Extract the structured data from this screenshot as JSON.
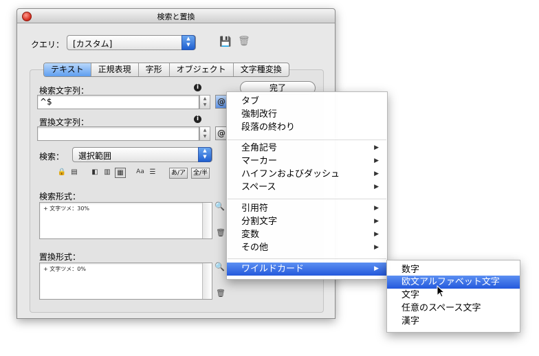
{
  "window": {
    "title": "検索と置換"
  },
  "query": {
    "label": "クエリ：",
    "value": "[カスタム]"
  },
  "tabs": [
    "テキスト",
    "正規表現",
    "字形",
    "オブジェクト",
    "文字種変換"
  ],
  "done_label": "完了",
  "find": {
    "label": "検索文字列：",
    "value": "^$"
  },
  "change": {
    "label": "置換文字列：",
    "value": ""
  },
  "search": {
    "label": "検索：",
    "value": "選択範囲"
  },
  "toggles": {
    "kana": "あ/ア",
    "width": "全/半"
  },
  "find_format": {
    "label": "検索形式：",
    "value": "+ 文字ツメ：30%"
  },
  "change_format": {
    "label": "置換形式：",
    "value": "+ 文字ツメ：0%"
  },
  "menu": {
    "group1": [
      "タブ",
      "強制改行",
      "段落の終わり"
    ],
    "group2": [
      "全角記号",
      "マーカー",
      "ハイフンおよびダッシュ",
      "スペース"
    ],
    "group3": [
      "引用符",
      "分割文字",
      "変数",
      "その他"
    ],
    "group4": [
      "ワイルドカード"
    ]
  },
  "submenu": [
    "数字",
    "欧文アルファベット文字",
    "文字",
    "任意のスペース文字",
    "漢字"
  ],
  "colors": {
    "selection": "#2f66e0",
    "tab_active": "#7fb2f5"
  }
}
